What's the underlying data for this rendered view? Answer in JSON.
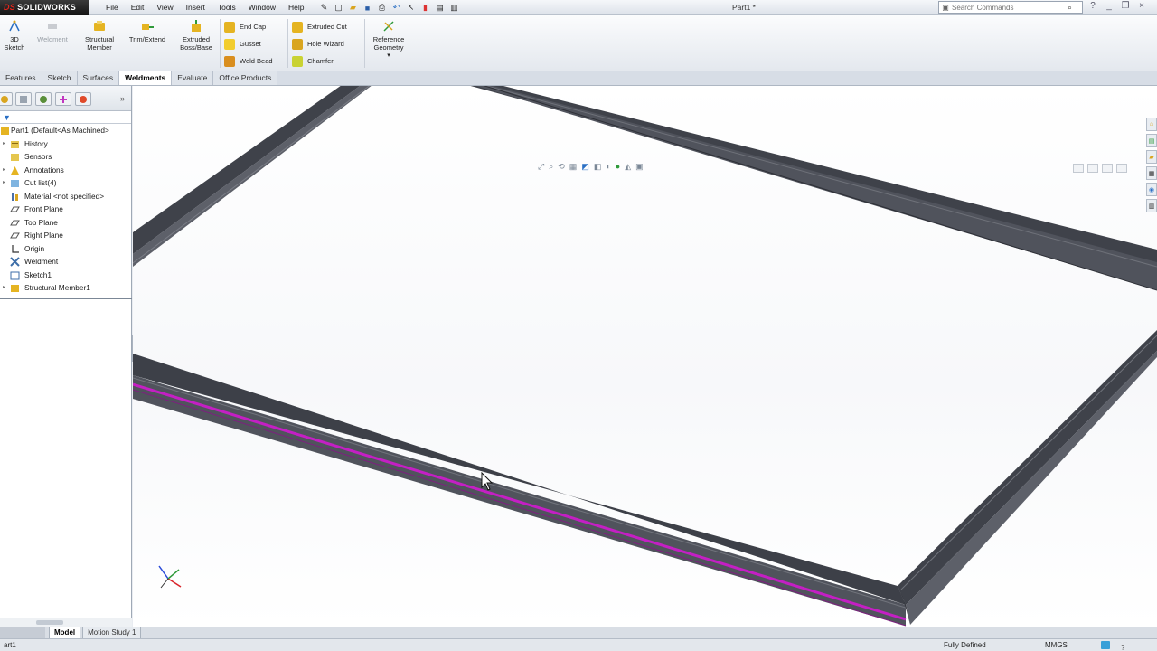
{
  "app": {
    "logo_prefix": "DS",
    "logo_name": "SOLIDWORKS",
    "document_title": "Part1 *"
  },
  "menu": [
    "File",
    "Edit",
    "View",
    "Insert",
    "Tools",
    "Window",
    "Help"
  ],
  "quick_access_icons": [
    "pin-icon",
    "new-document-icon",
    "open-icon",
    "save-icon",
    "print-icon",
    "undo-icon",
    "select-icon",
    "rebuild-icon",
    "file-properties-icon",
    "options-icon"
  ],
  "search": {
    "placeholder": "Search Commands"
  },
  "command_manager": {
    "sketch3d": "3D Sketch",
    "weldment": "Weldment",
    "structural_member": "Structural Member",
    "trim_extend": "Trim/Extend",
    "extruded_boss": "Extruded Boss/Base",
    "end_cap": "End Cap",
    "gusset": "Gusset",
    "weld_bead": "Weld Bead",
    "extruded_cut": "Extruded Cut",
    "hole_wizard": "Hole Wizard",
    "chamfer": "Chamfer",
    "reference_geometry": "Reference Geometry"
  },
  "tabs": [
    "Features",
    "Sketch",
    "Surfaces",
    "Weldments",
    "Evaluate",
    "Office Products"
  ],
  "active_tab": "Weldments",
  "feature_tree": {
    "root": "Part1  (Default<As Machined>",
    "items": [
      {
        "label": "History",
        "icon": "history-folder-icon"
      },
      {
        "label": "Sensors",
        "icon": "sensors-folder-icon"
      },
      {
        "label": "Annotations",
        "icon": "annotations-icon"
      },
      {
        "label": "Cut list(4)",
        "icon": "cut-list-icon"
      },
      {
        "label": "Material <not specified>",
        "icon": "material-icon"
      },
      {
        "label": "Front Plane",
        "icon": "plane-icon"
      },
      {
        "label": "Top Plane",
        "icon": "plane-icon"
      },
      {
        "label": "Right Plane",
        "icon": "plane-icon"
      },
      {
        "label": "Origin",
        "icon": "origin-icon"
      },
      {
        "label": "Weldment",
        "icon": "weldment-icon"
      },
      {
        "label": "Sketch1",
        "icon": "sketch-icon"
      },
      {
        "label": "Structural Member1",
        "icon": "structural-member-icon"
      }
    ]
  },
  "bottom_tabs": [
    "Model",
    "Motion Study 1"
  ],
  "active_bottom_tab": "Model",
  "status": {
    "left": "art1",
    "state": "Fully Defined",
    "units": "MMGS"
  },
  "colors": {
    "frame_dark": "#3f424a",
    "frame_top": "#5d6069",
    "highlight": "#c41fc4",
    "accent": "#2a6fc4"
  }
}
